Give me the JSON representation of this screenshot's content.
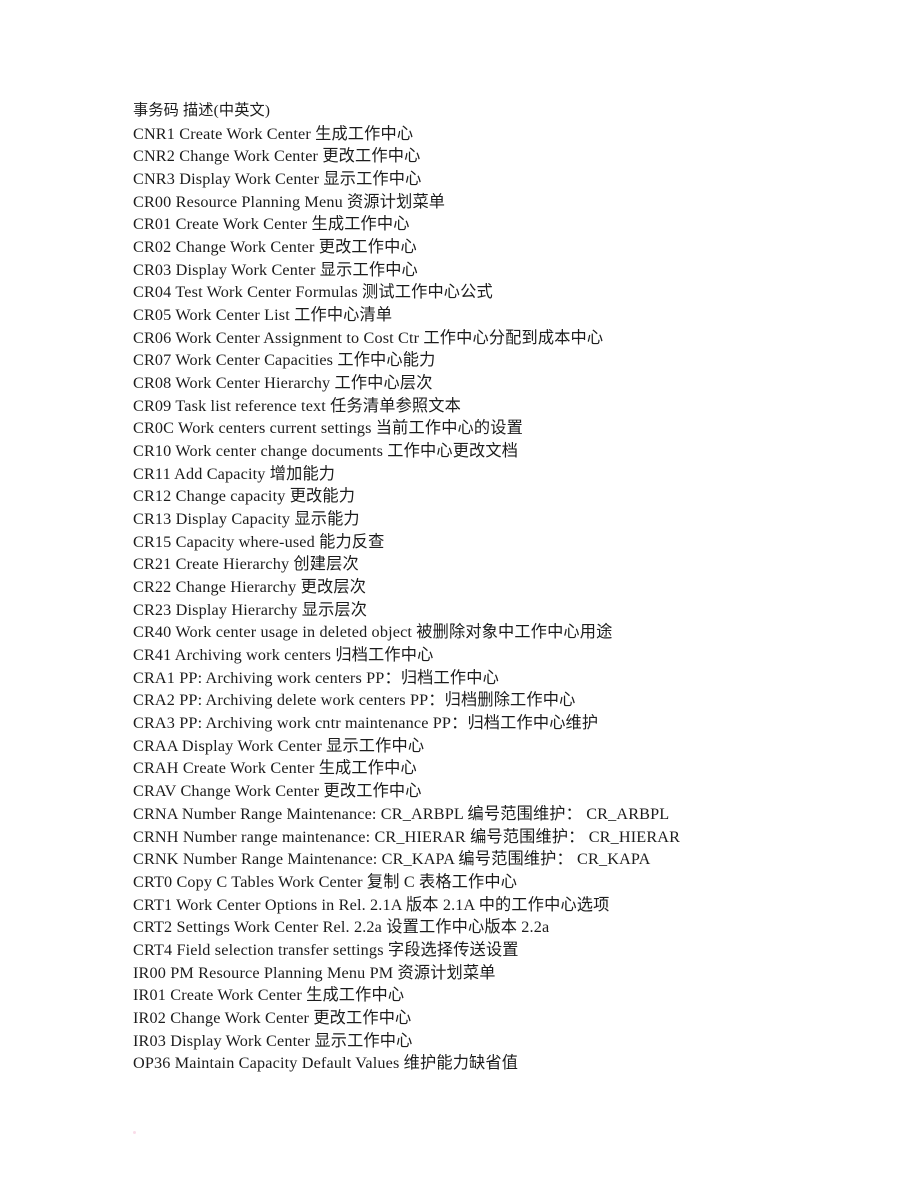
{
  "document": {
    "title": "事务码 描述(中英文)",
    "page_background": "#ffffff",
    "text_color": "#1c1c1c",
    "header": "事务码 描述(中英文)",
    "lines": [
      "事务码 描述(中英文)",
      "CNR1 Create Work Center 生成工作中心",
      "CNR2 Change Work Center 更改工作中心",
      "CNR3 Display Work Center 显示工作中心",
      "CR00 Resource Planning Menu 资源计划菜单",
      "CR01 Create Work Center 生成工作中心",
      "CR02 Change Work Center 更改工作中心",
      "CR03 Display Work Center 显示工作中心",
      "CR04 Test Work Center Formulas 测试工作中心公式",
      "CR05 Work Center List 工作中心清单",
      "CR06 Work Center Assignment to Cost Ctr 工作中心分配到成本中心",
      "CR07 Work Center Capacities 工作中心能力",
      "CR08 Work Center Hierarchy 工作中心层次",
      "CR09 Task list reference text 任务清单参照文本",
      "CR0C Work centers current settings 当前工作中心的设置",
      "CR10 Work center change documents 工作中心更改文档",
      "CR11 Add Capacity 增加能力",
      "CR12 Change capacity 更改能力",
      "CR13 Display Capacity 显示能力",
      "CR15 Capacity where-used 能力反查",
      "CR21 Create Hierarchy 创建层次",
      "CR22 Change Hierarchy 更改层次",
      "CR23 Display Hierarchy 显示层次",
      "CR40 Work center usage in deleted object 被删除对象中工作中心用途",
      "CR41 Archiving work centers 归档工作中心",
      "CRA1 PP: Archiving work centers PP：归档工作中心",
      "CRA2 PP: Archiving delete work centers PP：归档删除工作中心",
      "CRA3 PP: Archiving work cntr maintenance PP：归档工作中心维护",
      "CRAA Display Work Center 显示工作中心",
      "CRAH Create Work Center 生成工作中心",
      "CRAV Change Work Center 更改工作中心",
      "CRNA Number Range Maintenance: CR_ARBPL 编号范围维护： CR_ARBPL",
      "CRNH Number range maintenance: CR_HIERAR 编号范围维护： CR_HIERAR",
      "CRNK Number Range Maintenance: CR_KAPA 编号范围维护： CR_KAPA",
      "CRT0 Copy C Tables Work Center 复制 C 表格工作中心",
      "CRT1 Work Center Options in Rel. 2.1A 版本 2.1A 中的工作中心选项",
      "CRT2 Settings Work Center Rel. 2.2a 设置工作中心版本 2.2a",
      "CRT4 Field selection transfer settings 字段选择传送设置",
      "IR00 PM Resource Planning Menu PM 资源计划菜单",
      "IR01 Create Work Center 生成工作中心",
      "IR02 Change Work Center 更改工作中心",
      "IR03 Display Work Center 显示工作中心",
      "OP36 Maintain Capacity Default Values 维护能力缺省值"
    ],
    "entries": [
      {
        "code": "CNR1",
        "english": "Create Work Center",
        "chinese": "生成工作中心"
      },
      {
        "code": "CNR2",
        "english": "Change Work Center",
        "chinese": "更改工作中心"
      },
      {
        "code": "CNR3",
        "english": "Display Work Center",
        "chinese": "显示工作中心"
      },
      {
        "code": "CR00",
        "english": "Resource Planning Menu",
        "chinese": "资源计划菜单"
      },
      {
        "code": "CR01",
        "english": "Create Work Center",
        "chinese": "生成工作中心"
      },
      {
        "code": "CR02",
        "english": "Change Work Center",
        "chinese": "更改工作中心"
      },
      {
        "code": "CR03",
        "english": "Display Work Center",
        "chinese": "显示工作中心"
      },
      {
        "code": "CR04",
        "english": "Test Work Center Formulas",
        "chinese": "测试工作中心公式"
      },
      {
        "code": "CR05",
        "english": "Work Center List",
        "chinese": "工作中心清单"
      },
      {
        "code": "CR06",
        "english": "Work Center Assignment to Cost Ctr",
        "chinese": "工作中心分配到成本中心"
      },
      {
        "code": "CR07",
        "english": "Work Center Capacities",
        "chinese": "工作中心能力"
      },
      {
        "code": "CR08",
        "english": "Work Center Hierarchy",
        "chinese": "工作中心层次"
      },
      {
        "code": "CR09",
        "english": "Task list reference text",
        "chinese": "任务清单参照文本"
      },
      {
        "code": "CR0C",
        "english": "Work centers current settings",
        "chinese": "当前工作中心的设置"
      },
      {
        "code": "CR10",
        "english": "Work center change documents",
        "chinese": "工作中心更改文档"
      },
      {
        "code": "CR11",
        "english": "Add Capacity",
        "chinese": "增加能力"
      },
      {
        "code": "CR12",
        "english": "Change capacity",
        "chinese": "更改能力"
      },
      {
        "code": "CR13",
        "english": "Display Capacity",
        "chinese": "显示能力"
      },
      {
        "code": "CR15",
        "english": "Capacity where-used",
        "chinese": "能力反查"
      },
      {
        "code": "CR21",
        "english": "Create Hierarchy",
        "chinese": "创建层次"
      },
      {
        "code": "CR22",
        "english": "Change Hierarchy",
        "chinese": "更改层次"
      },
      {
        "code": "CR23",
        "english": "Display Hierarchy",
        "chinese": "显示层次"
      },
      {
        "code": "CR40",
        "english": "Work center usage in deleted object",
        "chinese": "被删除对象中工作中心用途"
      },
      {
        "code": "CR41",
        "english": "Archiving work centers",
        "chinese": "归档工作中心"
      },
      {
        "code": "CRA1",
        "english": "PP: Archiving work centers",
        "chinese": "PP：归档工作中心"
      },
      {
        "code": "CRA2",
        "english": "PP: Archiving delete work centers",
        "chinese": "PP：归档删除工作中心"
      },
      {
        "code": "CRA3",
        "english": "PP: Archiving work cntr maintenance",
        "chinese": "PP：归档工作中心维护"
      },
      {
        "code": "CRAA",
        "english": "Display Work Center",
        "chinese": "显示工作中心"
      },
      {
        "code": "CRAH",
        "english": "Create Work Center",
        "chinese": "生成工作中心"
      },
      {
        "code": "CRAV",
        "english": "Change Work Center",
        "chinese": "更改工作中心"
      },
      {
        "code": "CRNA",
        "english": "Number Range Maintenance: CR_ARBPL",
        "chinese": "编号范围维护： CR_ARBPL"
      },
      {
        "code": "CRNH",
        "english": "Number range maintenance: CR_HIERAR",
        "chinese": "编号范围维护： CR_HIERAR"
      },
      {
        "code": "CRNK",
        "english": "Number Range Maintenance: CR_KAPA",
        "chinese": "编号范围维护： CR_KAPA"
      },
      {
        "code": "CRT0",
        "english": "Copy C Tables Work Center",
        "chinese": "复制 C 表格工作中心"
      },
      {
        "code": "CRT1",
        "english": "Work Center Options in Rel. 2.1A",
        "chinese": "版本 2.1A 中的工作中心选项"
      },
      {
        "code": "CRT2",
        "english": "Settings Work Center Rel. 2.2a",
        "chinese": "设置工作中心版本 2.2a"
      },
      {
        "code": "CRT4",
        "english": "Field selection transfer settings",
        "chinese": "字段选择传送设置"
      },
      {
        "code": "IR00",
        "english": "PM Resource Planning Menu",
        "chinese": "PM 资源计划菜单"
      },
      {
        "code": "IR01",
        "english": "Create Work Center",
        "chinese": "生成工作中心"
      },
      {
        "code": "IR02",
        "english": "Change Work Center",
        "chinese": "更改工作中心"
      },
      {
        "code": "IR03",
        "english": "Display Work Center",
        "chinese": "显示工作中心"
      },
      {
        "code": "OP36",
        "english": "Maintain Capacity Default Values",
        "chinese": "维护能力缺省值"
      }
    ]
  }
}
